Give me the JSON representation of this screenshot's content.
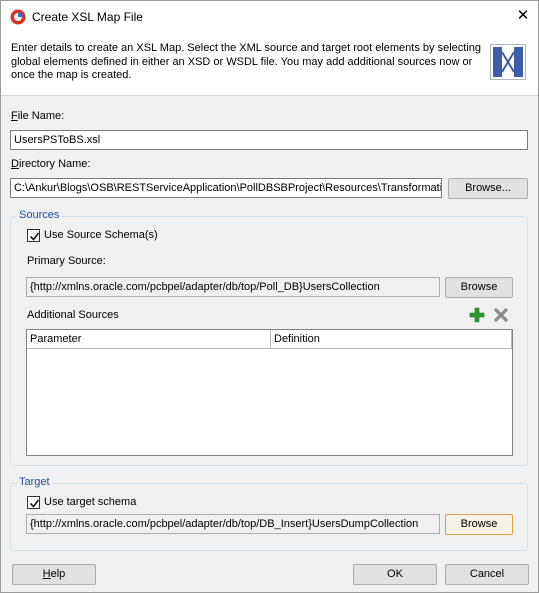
{
  "window": {
    "title": "Create XSL Map File",
    "close_glyph": "✕",
    "app_icon": "oracle-jdeveloper-icon"
  },
  "header": {
    "description": "Enter details to create an XSL Map. Select the XML source and target root elements by selecting global elements defined in either an XSD or WSDL file.  You may add additional sources now or once the map is created.",
    "logo_icon": "xsl-map-icon"
  },
  "file_name": {
    "label_mnemonic": "F",
    "label_rest": "ile Name:",
    "value": "UsersPSToBS.xsl"
  },
  "directory_name": {
    "label_mnemonic": "D",
    "label_rest": "irectory Name:",
    "value": "C:\\Ankur\\Blogs\\OSB\\RESTServiceApplication\\PollDBSBProject\\Resources\\Transformations",
    "browse_label": "Browse..."
  },
  "sources": {
    "title": "Sources",
    "use_schema_label": "Use Source Schema(s)",
    "use_schema_checked": true,
    "primary_label": "Primary Source:",
    "primary_value": "{http://xmlns.oracle.com/pcbpel/adapter/db/top/Poll_DB}UsersCollection",
    "browse_label": "Browse",
    "additional_label": "Additional Sources",
    "add_icon": "add-icon",
    "remove_icon": "remove-icon",
    "columns": [
      "Parameter",
      "Definition"
    ],
    "rows": []
  },
  "target": {
    "title": "Target",
    "use_schema_label": "Use target schema",
    "use_schema_checked": true,
    "value": "{http://xmlns.oracle.com/pcbpel/adapter/db/top/DB_Insert}UsersDumpCollection",
    "browse_label": "Browse"
  },
  "footer": {
    "help_mnemonic": "H",
    "help_rest": "elp",
    "ok_label": "OK",
    "cancel_label": "Cancel"
  },
  "colors": {
    "group_title": "#1f4e9a",
    "focus_border": "#e0a145",
    "add_icon": "#2e9a2e"
  }
}
